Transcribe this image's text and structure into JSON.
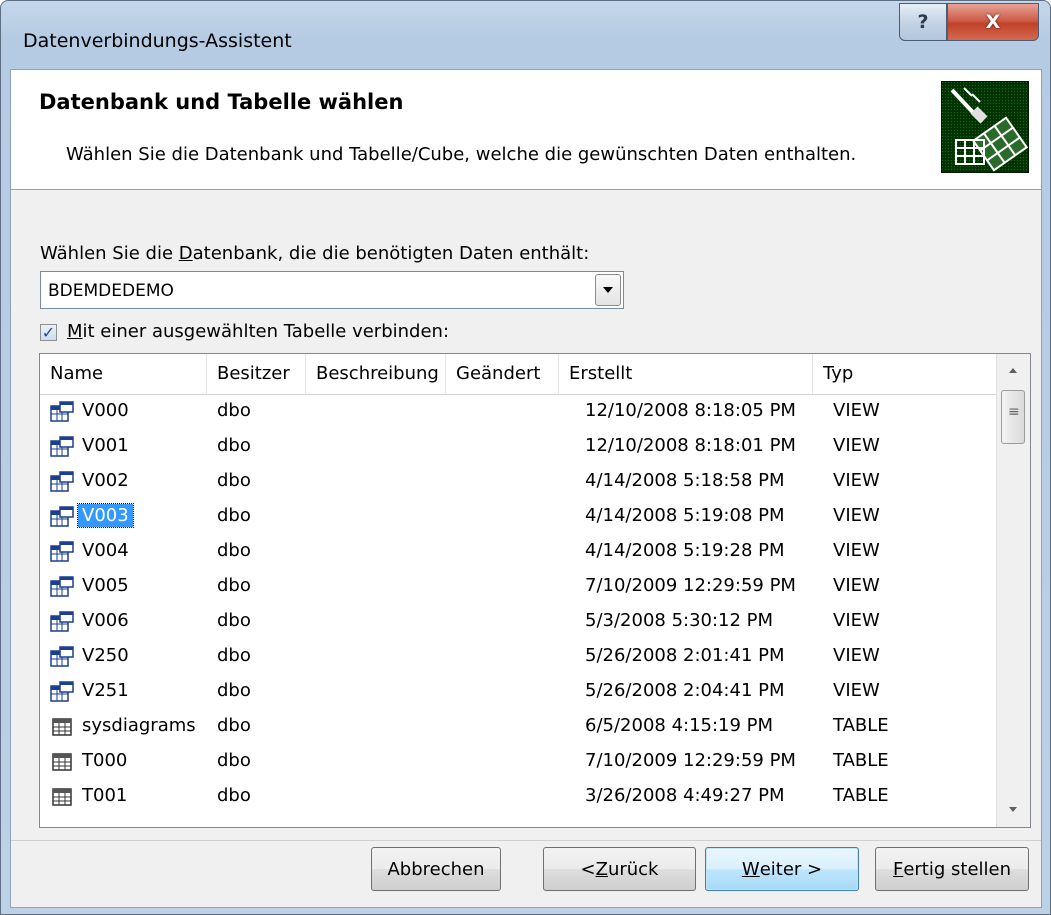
{
  "window": {
    "title": "Datenverbindungs-Assistent",
    "help_label": "?",
    "close_label": "X"
  },
  "header": {
    "title": "Datenbank und Tabelle wählen",
    "subtitle": "Wählen Sie die Datenbank und Tabelle/Cube, welche die gewünschten Daten enthalten."
  },
  "database": {
    "label_pre": "Wählen Sie die ",
    "label_access": "D",
    "label_post": "atenbank, die die benötigten Daten enthält:",
    "selected": "BDEMDEDEMO"
  },
  "connect_table": {
    "checked": true,
    "label_access": "M",
    "label_post": "it einer ausgewählten Tabelle verbinden:"
  },
  "table_list": {
    "columns": [
      "Name",
      "Besitzer",
      "Beschreibung",
      "Geändert",
      "Erstellt",
      "Typ"
    ],
    "rows": [
      {
        "icon": "view-icon",
        "name": "V000",
        "owner": "dbo",
        "description": "",
        "modified": "",
        "created": "12/10/2008 8:18:05 PM",
        "type": "VIEW"
      },
      {
        "icon": "view-icon",
        "name": "V001",
        "owner": "dbo",
        "description": "",
        "modified": "",
        "created": "12/10/2008 8:18:01 PM",
        "type": "VIEW"
      },
      {
        "icon": "view-icon",
        "name": "V002",
        "owner": "dbo",
        "description": "",
        "modified": "",
        "created": "4/14/2008 5:18:58 PM",
        "type": "VIEW"
      },
      {
        "icon": "view-icon",
        "name": "V003",
        "owner": "dbo",
        "description": "",
        "modified": "",
        "created": "4/14/2008 5:19:08 PM",
        "type": "VIEW",
        "selected": true
      },
      {
        "icon": "view-icon",
        "name": "V004",
        "owner": "dbo",
        "description": "",
        "modified": "",
        "created": "4/14/2008 5:19:28 PM",
        "type": "VIEW"
      },
      {
        "icon": "view-icon",
        "name": "V005",
        "owner": "dbo",
        "description": "",
        "modified": "",
        "created": "7/10/2009 12:29:59 PM",
        "type": "VIEW"
      },
      {
        "icon": "view-icon",
        "name": "V006",
        "owner": "dbo",
        "description": "",
        "modified": "",
        "created": "5/3/2008 5:30:12 PM",
        "type": "VIEW"
      },
      {
        "icon": "view-icon",
        "name": "V250",
        "owner": "dbo",
        "description": "",
        "modified": "",
        "created": "5/26/2008 2:01:41 PM",
        "type": "VIEW"
      },
      {
        "icon": "view-icon",
        "name": "V251",
        "owner": "dbo",
        "description": "",
        "modified": "",
        "created": "5/26/2008 2:04:41 PM",
        "type": "VIEW"
      },
      {
        "icon": "table-icon",
        "name": "sysdiagrams",
        "owner": "dbo",
        "description": "",
        "modified": "",
        "created": "6/5/2008 4:15:19 PM",
        "type": "TABLE"
      },
      {
        "icon": "table-icon",
        "name": "T000",
        "owner": "dbo",
        "description": "",
        "modified": "",
        "created": "7/10/2009 12:29:59 PM",
        "type": "TABLE"
      },
      {
        "icon": "table-icon",
        "name": "T001",
        "owner": "dbo",
        "description": "",
        "modified": "",
        "created": "3/26/2008 4:49:27 PM",
        "type": "TABLE"
      }
    ]
  },
  "buttons": {
    "cancel": "Abbrechen",
    "back_pre": "< ",
    "back_access": "Z",
    "back_post": "urück",
    "next_access": "W",
    "next_post": "eiter >",
    "finish_access": "F",
    "finish_post": "ertig stellen"
  },
  "colors": {
    "selection": "#3399ff",
    "title_bar": "#bcd0e6",
    "close_button": "#c1412b"
  }
}
